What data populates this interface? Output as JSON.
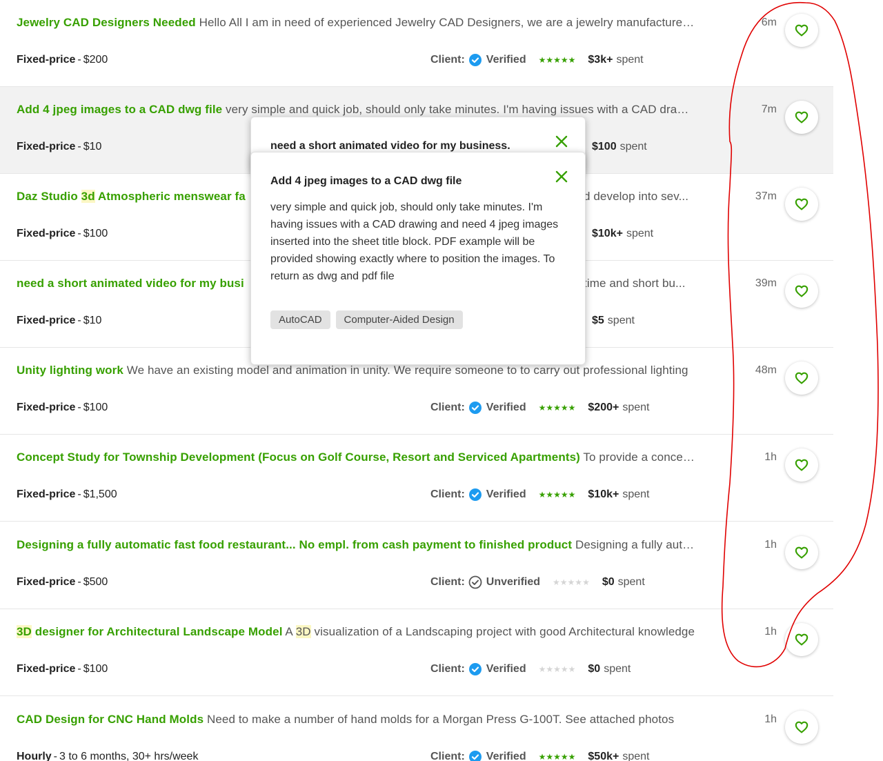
{
  "jobs": [
    {
      "title": "Jewelry CAD Designers Needed",
      "snippet": "Hello All I am in need of experienced Jewelry CAD Designers, we are a jewelry manufacturer looking for help",
      "price_type": "Fixed-price",
      "price_value": "$200",
      "time": "6m",
      "client_label": "Client:",
      "verification": "Verified",
      "stars": "★★★★★",
      "spent_amount": "$3k+",
      "spent_label": "spent"
    },
    {
      "title": "Add 4 jpeg images to a CAD dwg file",
      "snippet": "very simple and quick job, should only take minutes. I'm having issues with a CAD drawing",
      "price_type": "Fixed-price",
      "price_value": "$10",
      "time": "7m",
      "spent_amount": "$100",
      "spent_label": "spent"
    },
    {
      "title_before": "Daz Studio ",
      "title_hl": "3d",
      "title_after": " Atmospheric menswear fa",
      "snippet": "d develop into sev...",
      "price_type": "Fixed-price",
      "price_value": "$100",
      "time": "37m",
      "spent_amount": "$10k+",
      "spent_label": "spent"
    },
    {
      "title": "need a short animated video for my busi",
      "snippet": "time and short bu...",
      "price_type": "Fixed-price",
      "price_value": "$10",
      "time": "39m",
      "spent_amount": "$5",
      "spent_label": "spent"
    },
    {
      "title": "Unity lighting work",
      "snippet": "We have an existing model and animation in unity. We require someone to to carry out professional lighting",
      "price_type": "Fixed-price",
      "price_value": "$100",
      "time": "48m",
      "client_label": "Client:",
      "verification": "Verified",
      "stars": "★★★★★",
      "spent_amount": "$200+",
      "spent_label": "spent"
    },
    {
      "title": "Concept Study for Township Development (Focus on Golf Course, Resort and Serviced Apartments)",
      "snippet": "To provide a concept study",
      "price_type": "Fixed-price",
      "price_value": "$1,500",
      "time": "1h",
      "client_label": "Client:",
      "verification": "Verified",
      "stars": "★★★★★",
      "spent_amount": "$10k+",
      "spent_label": "spent"
    },
    {
      "title": "Designing a fully automatic fast food restaurant... No empl. from cash payment to finished product",
      "snippet": "Designing a fully automatic",
      "price_type": "Fixed-price",
      "price_value": "$500",
      "time": "1h",
      "client_label": "Client:",
      "verification": "Unverified",
      "stars": "★★★★★",
      "spent_amount": "$0",
      "spent_label": "spent"
    },
    {
      "title_hl": "3D",
      "title_after": " designer for Architectural Landscape Model",
      "snippet_before": " A ",
      "snippet_hl": "3D",
      "snippet_after": " visualization of a Landscaping project with good Architectural knowledge",
      "price_type": "Fixed-price",
      "price_value": "$100",
      "time": "1h",
      "client_label": "Client:",
      "verification": "Verified",
      "stars": "★★★★★",
      "spent_amount": "$0",
      "spent_label": "spent"
    },
    {
      "title": "CAD Design for CNC Hand Molds",
      "snippet": "Need to make a number of hand molds for a Morgan Press G-100T. See attached photos",
      "price_type": "Hourly",
      "price_value": "3 to 6 months, 30+ hrs/week",
      "time": "1h",
      "client_label": "Client:",
      "verification": "Verified",
      "stars": "★★★★★",
      "spent_amount": "$50k+",
      "spent_label": "spent"
    }
  ],
  "popup_back": {
    "title": "need a short animated video for my business."
  },
  "popup_front": {
    "title": "Add 4 jpeg images to a CAD dwg file",
    "description": "very simple and quick job, should only take minutes. I'm having issues with a CAD drawing and need 4 jpeg images inserted into the sheet title block. PDF example will be provided showing exactly where to position the images. To return as dwg and pdf file",
    "skills": [
      "AutoCAD",
      "Computer-Aided Design"
    ]
  },
  "colors": {
    "brand_green": "#37a000",
    "verified_blue": "#1d9bf0",
    "annotation_red": "#e00000",
    "highlight_yellow": "#fbf7c4"
  },
  "icons": {
    "favorite": "heart-outline-icon",
    "close": "x-close-icon",
    "verified": "check-badge-icon",
    "unverified": "check-circle-outline-icon",
    "rating": "star-icon"
  }
}
